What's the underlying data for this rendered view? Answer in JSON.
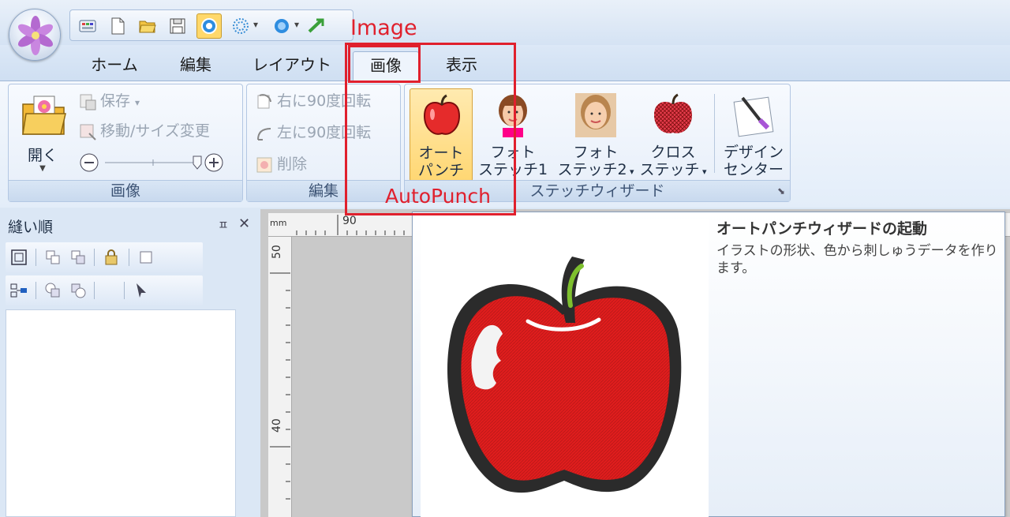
{
  "quick_access": {
    "icons": [
      "palette-icon",
      "new-file-icon",
      "open-folder-icon",
      "save-icon",
      "stitch-circle-icon",
      "burst-icon",
      "blue-circle-icon",
      "transfer-icon"
    ]
  },
  "tabs": [
    {
      "label": "ホーム"
    },
    {
      "label": "編集"
    },
    {
      "label": "レイアウト"
    },
    {
      "label": "画像"
    },
    {
      "label": "表示"
    }
  ],
  "ribbon": {
    "image_group": {
      "open_label": "開く",
      "save_label": "保存",
      "move_resize_label": "移動/サイズ変更",
      "group_label": "画像"
    },
    "edit_group": {
      "rotate_right_label": "右に90度回転",
      "rotate_left_label": "左に90度回転",
      "delete_label": "削除",
      "group_label": "編集"
    },
    "stitch_group": {
      "autopunch_label_1": "オート",
      "autopunch_label_2": "パンチ",
      "photo1_label_1": "フォト",
      "photo1_label_2": "ステッチ1",
      "photo2_label_1": "フォト",
      "photo2_label_2": "ステッチ2",
      "cross_label_1": "クロス",
      "cross_label_2": "ステッチ",
      "design_label_1": "デザイン",
      "design_label_2": "センター",
      "group_label": "ステッチウィザード"
    }
  },
  "annotations": {
    "image_label": "Image",
    "autopunch_label": "AutoPunch"
  },
  "sew_panel": {
    "title": "縫い順",
    "pin": "ㅍ",
    "close": "✕"
  },
  "ruler": {
    "unit": "mm",
    "top_mark": "90",
    "left_mark_1": "50",
    "left_mark_2": "40"
  },
  "tooltip": {
    "title": "オートパンチウィザードの起動",
    "description": "イラストの形状、色から刺しゅうデータを作ります。"
  },
  "colors": {
    "annotation_red": "#e0202d",
    "apple_red": "#e02020"
  }
}
